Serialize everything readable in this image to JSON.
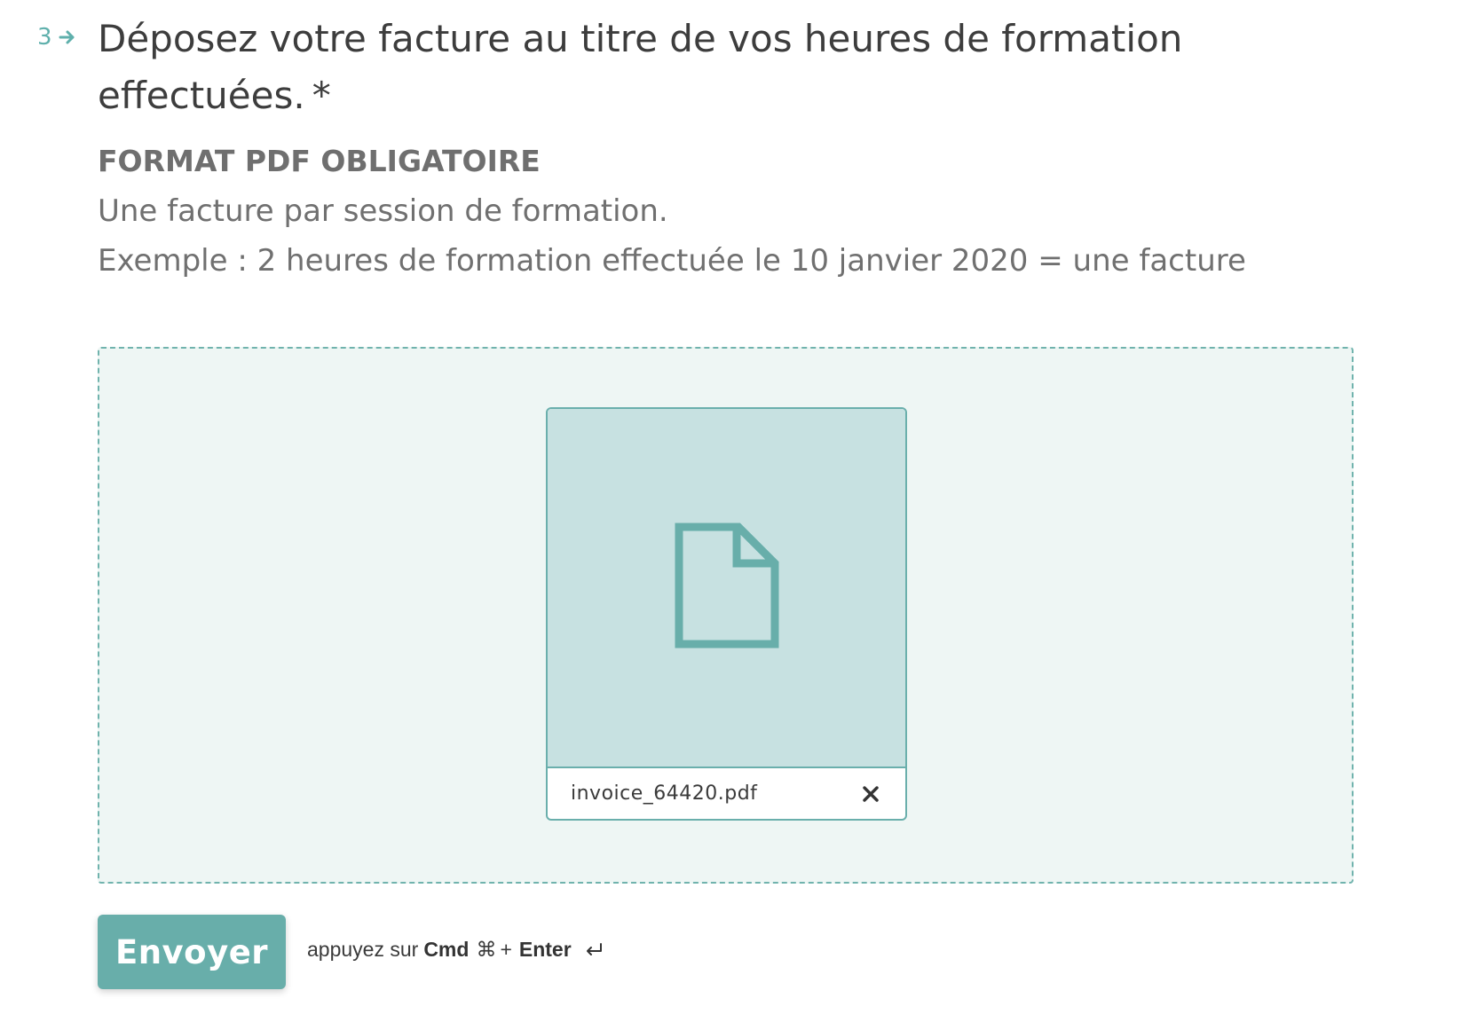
{
  "question": {
    "number": "3",
    "title": "Déposez votre facture au titre de vos heures de formation effectuées.",
    "required_marker": "*",
    "subtitle": "FORMAT PDF OBLIGATOIRE",
    "description_lines": [
      "Une facture par session de formation.",
      "Exemple : 2 heures de formation effectuée le 10 janvier 2020 = une facture"
    ]
  },
  "upload": {
    "file_name": "invoice_64420.pdf",
    "file_icon": "document-icon",
    "remove_icon": "close-icon"
  },
  "submit": {
    "button_label": "Envoyer",
    "hint_prefix": "appuyez sur",
    "hint_key1": "Cmd",
    "hint_cmd_symbol": "⌘",
    "hint_plus": "+",
    "hint_key2": "Enter",
    "hint_enter_icon": "enter-return-icon"
  },
  "colors": {
    "accent": "#68aeaa",
    "dropzone_bg": "#eef6f4",
    "preview_bg": "#c7e1e1",
    "title_text": "#3d3d3d",
    "secondary_text": "#707070"
  }
}
